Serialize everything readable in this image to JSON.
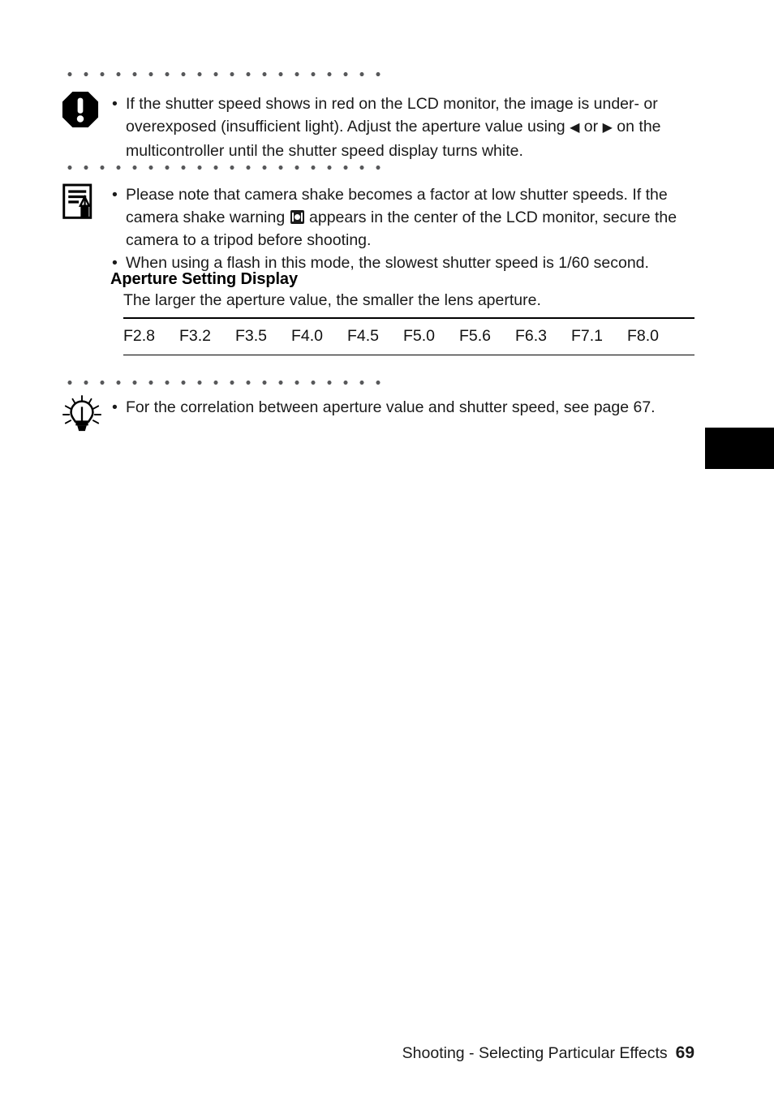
{
  "document": {
    "page_number": "69",
    "footer_title": "Shooting - Selecting Particular Effects"
  },
  "callouts": [
    {
      "icon": "warning-octagon-icon",
      "bullets": [
        {
          "parts": [
            {
              "type": "text",
              "value": "If the shutter speed shows in red on the LCD monitor, the image is under- or overexposed (insufficient light). Adjust the aperture value using "
            },
            {
              "type": "glyph",
              "value": "◀"
            },
            {
              "type": "text",
              "value": " or "
            },
            {
              "type": "glyph",
              "value": "▶"
            },
            {
              "type": "text",
              "value": " on the multicontroller until the shutter speed display turns white."
            }
          ]
        }
      ]
    },
    {
      "icon": "note-document-pencil-icon",
      "bullets": [
        {
          "parts": [
            {
              "type": "text",
              "value": "Please note that camera shake becomes a factor at low shutter speeds. If the camera shake warning "
            },
            {
              "type": "icon",
              "value": "camera-shake-warning-icon"
            },
            {
              "type": "text",
              "value": " appears in the center of the LCD monitor, secure the camera to a tripod before shooting."
            }
          ]
        },
        {
          "parts": [
            {
              "type": "text",
              "value": "When using a flash in this mode, the slowest shutter speed is 1/60 second."
            }
          ]
        }
      ]
    },
    {
      "icon": "tip-lightbulb-icon",
      "bullets": [
        {
          "parts": [
            {
              "type": "text",
              "value": "For the correlation between aperture value and shutter speed, see page 67."
            }
          ]
        }
      ]
    }
  ],
  "aperture_section": {
    "heading": "Aperture Setting Display",
    "subtitle": "The larger the aperture value, the smaller the lens aperture.",
    "values": [
      "F2.8",
      "F3.2",
      "F3.5",
      "F4.0",
      "F4.5",
      "F5.0",
      "F5.6",
      "F6.3",
      "F7.1",
      "F8.0"
    ]
  },
  "bullet_char": "•",
  "colors": {
    "text": "#1a1a1a",
    "dot_rule": "#58595b",
    "rule": "#000000",
    "thumb_tab": "#000000"
  }
}
